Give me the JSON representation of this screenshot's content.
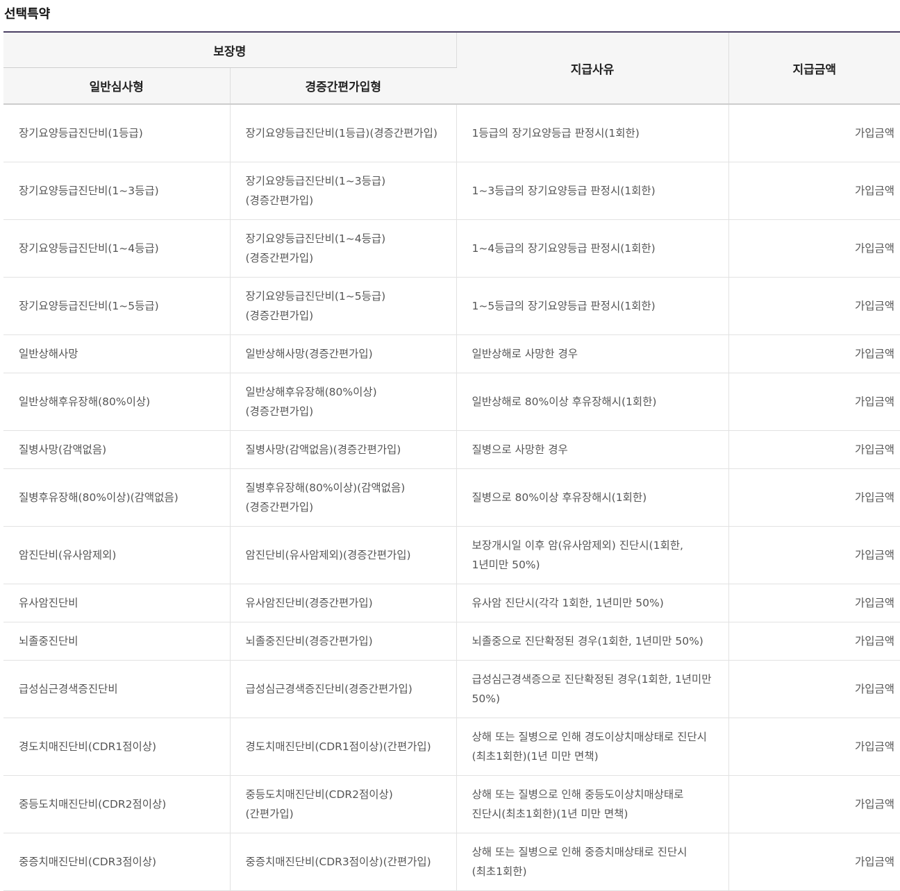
{
  "section": {
    "title": "선택특약"
  },
  "table": {
    "headers": {
      "coverage_name": "보장명",
      "general_type": "일반심사형",
      "simplified_type": "경증간편가입형",
      "payment_reason": "지급사유",
      "payment_amount": "지급금액"
    },
    "rows": [
      {
        "general": "장기요양등급진단비(1등급)",
        "simplified": "장기요양등급진단비(1등급)(경증간편가입)",
        "reason": "1등급의 장기요양등급 판정시(1회한)",
        "amount": "가입금액"
      },
      {
        "general": "장기요양등급진단비(1~3등급)",
        "simplified": "장기요양등급진단비(1~3등급)(경증간편가입)",
        "reason": "1~3등급의 장기요양등급 판정시(1회한)",
        "amount": "가입금액"
      },
      {
        "general": "장기요양등급진단비(1~4등급)",
        "simplified": "장기요양등급진단비(1~4등급)(경증간편가입)",
        "reason": "1~4등급의 장기요양등급 판정시(1회한)",
        "amount": "가입금액"
      },
      {
        "general": "장기요양등급진단비(1~5등급)",
        "simplified": "장기요양등급진단비(1~5등급)(경증간편가입)",
        "reason": "1~5등급의 장기요양등급 판정시(1회한)",
        "amount": "가입금액"
      },
      {
        "general": "일반상해사망",
        "simplified": "일반상해사망(경증간편가입)",
        "reason": "일반상해로 사망한 경우",
        "amount": "가입금액"
      },
      {
        "general": "일반상해후유장해(80%이상)",
        "simplified": "일반상해후유장해(80%이상)(경증간편가입)",
        "reason": "일반상해로 80%이상 후유장해시(1회한)",
        "amount": "가입금액"
      },
      {
        "general": "질병사망(감액없음)",
        "simplified": "질병사망(감액없음)(경증간편가입)",
        "reason": "질병으로 사망한 경우",
        "amount": "가입금액"
      },
      {
        "general": "질병후유장해(80%이상)(감액없음)",
        "simplified": "질병후유장해(80%이상)(감액없음)(경증간편가입)",
        "reason": "질병으로 80%이상 후유장해시(1회한)",
        "amount": "가입금액"
      },
      {
        "general": "암진단비(유사암제외)",
        "simplified": "암진단비(유사암제외)(경증간편가입)",
        "reason": "보장개시일 이후 암(유사암제외) 진단시(1회한, 1년미만 50%)",
        "amount": "가입금액"
      },
      {
        "general": "유사암진단비",
        "simplified": "유사암진단비(경증간편가입)",
        "reason": "유사암 진단시(각각 1회한, 1년미만 50%)",
        "amount": "가입금액"
      },
      {
        "general": "뇌졸중진단비",
        "simplified": "뇌졸중진단비(경증간편가입)",
        "reason": "뇌졸중으로 진단확정된 경우(1회한, 1년미만 50%)",
        "amount": "가입금액"
      },
      {
        "general": "급성심근경색증진단비",
        "simplified": "급성심근경색증진단비(경증간편가입)",
        "reason": "급성심근경색증으로 진단확정된 경우(1회한, 1년미만 50%)",
        "amount": "가입금액"
      },
      {
        "general": "경도치매진단비(CDR1점이상)",
        "simplified": "경도치매진단비(CDR1점이상)(간편가입)",
        "reason": "상해 또는 질병으로 인해 경도이상치매상태로 진단시(최초1회한)(1년 미만 면책)",
        "amount": "가입금액"
      },
      {
        "general": "중등도치매진단비(CDR2점이상)",
        "simplified": "중등도치매진단비(CDR2점이상)(간편가입)",
        "reason": "상해 또는 질병으로 인해 중등도이상치매상태로 진단시(최초1회한)(1년 미만 면책)",
        "amount": "가입금액"
      },
      {
        "general": "중증치매진단비(CDR3점이상)",
        "simplified": "중증치매진단비(CDR3점이상)(간편가입)",
        "reason": "상해 또는 질병으로 인해 중증치매상태로 진단시(최초1회한)",
        "amount": "가입금액"
      }
    ]
  }
}
